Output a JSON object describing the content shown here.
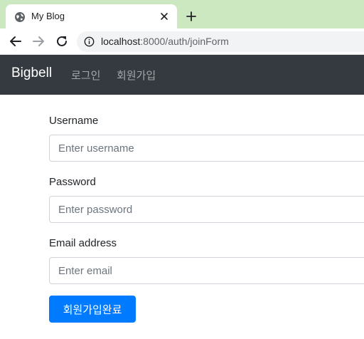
{
  "browser": {
    "tab_title": "My Blog",
    "url_host": "localhost",
    "url_rest": ":8000/auth/joinForm"
  },
  "navbar": {
    "brand": "Bigbell",
    "links": [
      {
        "label": "로그인"
      },
      {
        "label": "회원가입"
      }
    ],
    "background": "#343a40"
  },
  "form": {
    "username": {
      "label": "Username",
      "placeholder": "Enter username",
      "value": ""
    },
    "password": {
      "label": "Password",
      "placeholder": "Enter password",
      "value": ""
    },
    "email": {
      "label": "Email address",
      "placeholder": "Enter email",
      "value": ""
    },
    "submit_label": "회원가입완료",
    "submit_color": "#007bff"
  },
  "icons": {
    "favicon": "globe-icon",
    "close": "close-icon",
    "new_tab": "plus-icon",
    "back": "arrow-left-icon",
    "forward": "arrow-right-icon",
    "reload": "reload-icon",
    "info": "info-icon"
  }
}
